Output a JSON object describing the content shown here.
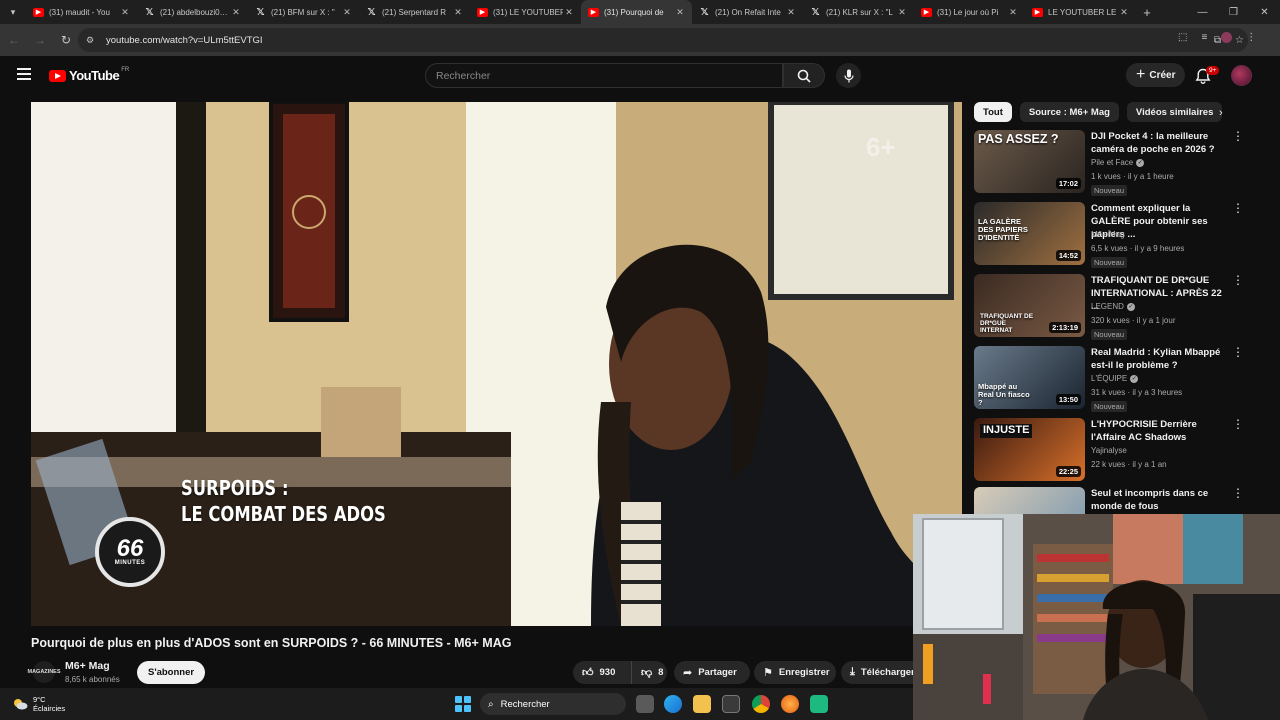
{
  "browser": {
    "tabs": [
      {
        "icon": "youtube",
        "title": "(31) maudit - You"
      },
      {
        "icon": "x",
        "title": "(21) abdelbouzi0…"
      },
      {
        "icon": "x",
        "title": "(21) BFM sur X : \""
      },
      {
        "icon": "x",
        "title": "(21) Serpentard R"
      },
      {
        "icon": "youtube",
        "title": "(31) LE YOUTUBER"
      },
      {
        "icon": "youtube",
        "title": "(31) Pourquoi de",
        "active": true
      },
      {
        "icon": "x",
        "title": "(21) On Refait Inte"
      },
      {
        "icon": "x",
        "title": "(21) KLR sur X : \"L"
      },
      {
        "icon": "youtube",
        "title": "(31) Le jour où Pi"
      },
      {
        "icon": "youtube",
        "title": "LE YOUTUBER LE"
      }
    ],
    "url": "youtube.com/watch?v=ULm5ttEVTGI"
  },
  "youtube": {
    "logo_text": "YouTube",
    "country_code": "FR",
    "search_placeholder": "Rechercher",
    "create_label": "Créer",
    "notif_count": "9+"
  },
  "video": {
    "overlay_line1": "SURPOIDS :",
    "overlay_line2": "LE COMBAT DES ADOS",
    "badge_number": "66",
    "badge_label": "MINUTES",
    "title": "Pourquoi de plus en plus d'ADOS sont en SURPOIDS ? - 66 MINUTES - M6+ MAG",
    "channel": {
      "name": "M6+ Mag",
      "subscribers": "8,65 k abonnés",
      "avatar_text": "MAGAZINES",
      "subscribe_label": "S'abonner"
    },
    "actions": {
      "likes": "930",
      "dislikes": "8",
      "share": "Partager",
      "save": "Enregistrer",
      "download": "Télécharger"
    }
  },
  "sidebar": {
    "chips": [
      "Tout",
      "Source : M6+ Mag",
      "Vidéos similaires"
    ],
    "recommendations": [
      {
        "title": "DJI Pocket 4 : la meilleure caméra de poche en 2026 ?",
        "channel": "Pile et Face",
        "verified": true,
        "meta": "1 k vues · il y a 1 heure",
        "badge": "Nouveau",
        "duration": "17:02",
        "thumb_text": "PAS ASSEZ ?"
      },
      {
        "title": "Comment expliquer la GALÈRE pour obtenir ses papiers ...",
        "channel": "M6+ Mag",
        "verified": false,
        "meta": "6,5 k vues · il y a 9 heures",
        "badge": "Nouveau",
        "duration": "14:52",
        "thumb_text": "LA GALÈRE DES PAPIERS D'IDENTITÉ"
      },
      {
        "title": "TRAFIQUANT DE DR*GUE INTERNATIONAL : APRÈS 22 ...",
        "channel": "LEGEND",
        "verified": true,
        "meta": "320 k vues · il y a 1 jour",
        "badge": "Nouveau",
        "duration": "2:13:19",
        "thumb_text": "TRAFIQUANT DE DR*GUE INTERNAT"
      },
      {
        "title": "Real Madrid : Kylian Mbappé est-il le problème ?",
        "channel": "L'ÉQUIPE",
        "verified": true,
        "meta": "31 k vues · il y a 3 heures",
        "badge": "Nouveau",
        "duration": "13:50",
        "thumb_text": "Mbappé au Real Un fiasco ?"
      },
      {
        "title": "L'HYPOCRISIE Derrière l'Affaire AC Shadows",
        "channel": "Yajinalyse",
        "verified": false,
        "meta": "22 k vues · il y a 1 an",
        "badge": "",
        "duration": "22:25",
        "thumb_text": "INJUSTE"
      },
      {
        "title": "Seul et incompris dans ce monde de fous",
        "channel": "",
        "verified": false,
        "meta": "",
        "badge": "",
        "duration": "",
        "thumb_text": ""
      }
    ]
  },
  "taskbar": {
    "temperature": "9°C",
    "weather": "Éclaircies",
    "search_label": "Rechercher"
  }
}
